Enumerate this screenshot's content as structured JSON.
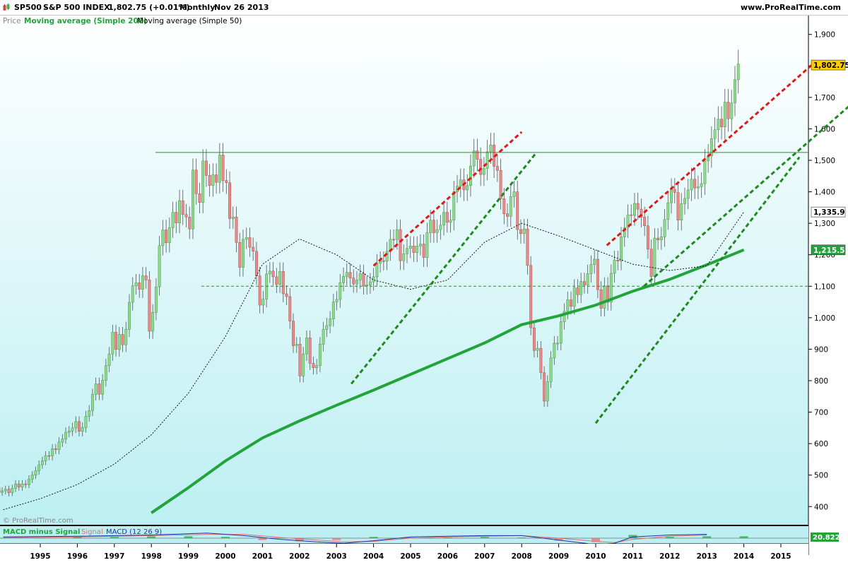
{
  "header": {
    "symbol": "SP500",
    "separator": "-",
    "name": "S&P 500 INDEX",
    "price_change": "1,802.75 (+0.01%)",
    "period": "Monthly",
    "date": "Nov 26 2013",
    "site": "www.ProRealTime.com"
  },
  "legend": {
    "price": "Price",
    "ma200": "Moving average (Simple 200)",
    "ma50": "Moving average (Simple 50)"
  },
  "macd_legend": {
    "hist": "MACD minus Signal",
    "signal": "Signal",
    "macd": "MACD (12 26 9)"
  },
  "watermark": "© ProRealTime.com",
  "colors": {
    "background_top": "#ffffff",
    "background_bottom": "#bff0f2",
    "up_candle": "#8fd98f",
    "down_candle": "#e88a8a",
    "ma200": "#22a43a",
    "ma50": "#000000",
    "support_line": "#1e8a1e",
    "resistance_line": "#e01818",
    "hline": "#2e8b2e",
    "price_badge": "#ffcc00",
    "ma200_badge": "#22a43a"
  },
  "chart_data": {
    "type": "candlestick",
    "period": "Monthly",
    "y_axis": {
      "ticks": [
        "400",
        "500",
        "600",
        "700",
        "800",
        "900",
        "1,000",
        "1,100",
        "1,200",
        "1,300",
        "1,400",
        "1,500",
        "1,600",
        "1,700",
        "1,800",
        "1,900"
      ],
      "tick_values": [
        400,
        500,
        600,
        700,
        800,
        900,
        1000,
        1100,
        1200,
        1300,
        1400,
        1500,
        1600,
        1700,
        1800,
        1900
      ],
      "range": [
        340,
        1960
      ]
    },
    "x_axis": {
      "ticks": [
        "1995",
        "1996",
        "1997",
        "1998",
        "1999",
        "2000",
        "2001",
        "2002",
        "2003",
        "2004",
        "2005",
        "2006",
        "2007",
        "2008",
        "2009",
        "2010",
        "2011",
        "2012",
        "2013",
        "2014",
        "2015"
      ],
      "range": [
        1994.0,
        2016.0
      ]
    },
    "last_price": {
      "value": 1802.75,
      "label": "1,802.75"
    },
    "ma50_last": {
      "value": 1335.9,
      "label": "1,335.9"
    },
    "ma200_last": {
      "value": 1215.5,
      "label": "1,215.5"
    },
    "closes": [
      [
        1994.0,
        476
      ],
      [
        1994.1,
        460
      ],
      [
        1994.2,
        445
      ],
      [
        1994.3,
        450
      ],
      [
        1994.4,
        455
      ],
      [
        1994.5,
        444
      ],
      [
        1994.6,
        458
      ],
      [
        1994.7,
        472
      ],
      [
        1994.8,
        462
      ],
      [
        1994.9,
        472
      ],
      [
        1995.0,
        470
      ],
      [
        1995.1,
        487
      ],
      [
        1995.2,
        500
      ],
      [
        1995.3,
        514
      ],
      [
        1995.4,
        533
      ],
      [
        1995.5,
        545
      ],
      [
        1995.6,
        562
      ],
      [
        1995.7,
        561
      ],
      [
        1995.8,
        584
      ],
      [
        1995.9,
        581
      ],
      [
        1996.0,
        605
      ],
      [
        1996.1,
        615
      ],
      [
        1996.2,
        636
      ],
      [
        1996.3,
        640
      ],
      [
        1996.4,
        650
      ],
      [
        1996.5,
        670
      ],
      [
        1996.6,
        639
      ],
      [
        1996.7,
        651
      ],
      [
        1996.8,
        687
      ],
      [
        1996.9,
        705
      ],
      [
        1997.0,
        756
      ],
      [
        1997.1,
        790
      ],
      [
        1997.2,
        757
      ],
      [
        1997.3,
        801
      ],
      [
        1997.4,
        848
      ],
      [
        1997.5,
        885
      ],
      [
        1997.6,
        954
      ],
      [
        1997.7,
        899
      ],
      [
        1997.8,
        947
      ],
      [
        1997.9,
        914
      ],
      [
        1998.0,
        963
      ],
      [
        1998.1,
        1049
      ],
      [
        1998.2,
        1101
      ],
      [
        1998.3,
        1111
      ],
      [
        1998.4,
        1090
      ],
      [
        1998.5,
        1133
      ],
      [
        1998.6,
        1120
      ],
      [
        1998.7,
        957
      ],
      [
        1998.8,
        1017
      ],
      [
        1998.9,
        1098
      ],
      [
        1999.0,
        1229
      ],
      [
        1999.1,
        1279
      ],
      [
        1999.2,
        1238
      ],
      [
        1999.3,
        1286
      ],
      [
        1999.4,
        1335
      ],
      [
        1999.5,
        1301
      ],
      [
        1999.6,
        1372
      ],
      [
        1999.7,
        1328
      ],
      [
        1999.8,
        1320
      ],
      [
        1999.9,
        1282
      ],
      [
        2000.0,
        1469
      ],
      [
        2000.1,
        1394
      ],
      [
        2000.2,
        1366
      ],
      [
        2000.3,
        1498
      ],
      [
        2000.4,
        1452
      ],
      [
        2000.5,
        1420
      ],
      [
        2000.6,
        1454
      ],
      [
        2000.7,
        1430
      ],
      [
        2000.8,
        1517
      ],
      [
        2000.9,
        1436
      ],
      [
        2001.0,
        1429
      ],
      [
        2001.1,
        1315
      ],
      [
        2001.2,
        1320
      ],
      [
        2001.3,
        1239
      ],
      [
        2001.4,
        1160
      ],
      [
        2001.5,
        1249
      ],
      [
        2001.6,
        1255
      ],
      [
        2001.7,
        1224
      ],
      [
        2001.8,
        1211
      ],
      [
        2001.9,
        1133
      ],
      [
        2002.0,
        1040
      ],
      [
        2002.1,
        1059
      ],
      [
        2002.2,
        1139
      ],
      [
        2002.3,
        1148
      ],
      [
        2002.4,
        1130
      ],
      [
        2002.5,
        1106
      ],
      [
        2002.6,
        1147
      ],
      [
        2002.7,
        1076
      ],
      [
        2002.8,
        1067
      ],
      [
        2002.9,
        989
      ],
      [
        2003.0,
        911
      ],
      [
        2003.1,
        916
      ],
      [
        2003.2,
        815
      ],
      [
        2003.3,
        885
      ],
      [
        2003.4,
        936
      ],
      [
        2003.5,
        855
      ],
      [
        2003.6,
        841
      ],
      [
        2003.7,
        848
      ],
      [
        2003.8,
        916
      ],
      [
        2003.9,
        963
      ],
      [
        2004.0,
        975
      ],
      [
        2004.1,
        996
      ],
      [
        2004.2,
        1050
      ],
      [
        2004.3,
        1058
      ],
      [
        2004.4,
        1111
      ],
      [
        2004.5,
        1131
      ],
      [
        2004.6,
        1144
      ],
      [
        2004.7,
        1126
      ],
      [
        2004.8,
        1107
      ],
      [
        2004.9,
        1120
      ],
      [
        2005.0,
        1140
      ],
      [
        2005.1,
        1101
      ],
      [
        2005.2,
        1104
      ],
      [
        2005.3,
        1114
      ],
      [
        2005.4,
        1130
      ],
      [
        2005.5,
        1173
      ],
      [
        2005.6,
        1181
      ],
      [
        2005.7,
        1180
      ],
      [
        2005.8,
        1211
      ],
      [
        2005.9,
        1249
      ],
      [
        2006.0,
        1248
      ],
      [
        2006.1,
        1280
      ],
      [
        2006.2,
        1181
      ],
      [
        2006.3,
        1203
      ],
      [
        2006.4,
        1220
      ],
      [
        2006.5,
        1228
      ],
      [
        2006.6,
        1207
      ],
      [
        2006.7,
        1228
      ],
      [
        2006.8,
        1234
      ],
      [
        2006.9,
        1191
      ],
      [
        2007.0,
        1270
      ],
      [
        2007.1,
        1310
      ],
      [
        2007.2,
        1270
      ],
      [
        2007.3,
        1280
      ],
      [
        2007.4,
        1294
      ],
      [
        2007.5,
        1335
      ],
      [
        2007.6,
        1303
      ],
      [
        2007.7,
        1310
      ],
      [
        2007.8,
        1400
      ],
      [
        2007.9,
        1418
      ],
      [
        2008.0,
        1438
      ],
      [
        2008.1,
        1406
      ],
      [
        2008.2,
        1420
      ],
      [
        2008.3,
        1482
      ],
      [
        2008.4,
        1530
      ],
      [
        2008.5,
        1503
      ],
      [
        2008.6,
        1455
      ],
      [
        2008.7,
        1474
      ],
      [
        2008.8,
        1527
      ],
      [
        2008.9,
        1549
      ],
      [
        2009.0,
        1481
      ],
      [
        2009.1,
        1468
      ],
      [
        2009.2,
        1378
      ],
      [
        2009.3,
        1330
      ],
      [
        2009.4,
        1322
      ],
      [
        2009.5,
        1385
      ],
      [
        2009.6,
        1400
      ],
      [
        2009.7,
        1280
      ],
      [
        2009.8,
        1267
      ],
      [
        2009.9,
        1282
      ],
      [
        2010.0,
        1166
      ],
      [
        2010.1,
        968
      ],
      [
        2010.2,
        896
      ],
      [
        2010.3,
        903
      ],
      [
        2010.4,
        825
      ],
      [
        2010.5,
        735
      ],
      [
        2010.6,
        797
      ],
      [
        2010.7,
        872
      ],
      [
        2010.8,
        919
      ],
      [
        2010.9,
        919
      ],
      [
        2011.0,
        987
      ],
      [
        2011.1,
        1020
      ],
      [
        2011.2,
        1057
      ],
      [
        2011.3,
        1036
      ],
      [
        2011.4,
        1095
      ],
      [
        2011.5,
        1073
      ],
      [
        2011.6,
        1115
      ],
      [
        2011.7,
        1104
      ],
      [
        2011.8,
        1140
      ],
      [
        2011.9,
        1169
      ],
      [
        2012.0,
        1186
      ],
      [
        2012.1,
        1089
      ],
      [
        2012.2,
        1030
      ],
      [
        2012.3,
        1101
      ],
      [
        2012.4,
        1049
      ],
      [
        2012.5,
        1141
      ],
      [
        2012.6,
        1183
      ],
      [
        2012.7,
        1180
      ],
      [
        2012.8,
        1257
      ],
      [
        2012.9,
        1286
      ],
      [
        2013.0,
        1327
      ],
      [
        2013.1,
        1325
      ],
      [
        2013.2,
        1363
      ],
      [
        2013.3,
        1345
      ],
      [
        2013.4,
        1320
      ],
      [
        2013.5,
        1292
      ],
      [
        2013.6,
        1218
      ],
      [
        2013.7,
        1131
      ],
      [
        2013.8,
        1253
      ],
      [
        2013.9,
        1247
      ],
      [
        2014.0,
        1257
      ],
      [
        2014.1,
        1312
      ],
      [
        2014.2,
        1365
      ],
      [
        2014.3,
        1408
      ],
      [
        2014.4,
        1398
      ],
      [
        2014.5,
        1310
      ],
      [
        2014.6,
        1362
      ],
      [
        2014.7,
        1379
      ],
      [
        2014.8,
        1406
      ],
      [
        2014.9,
        1440
      ],
      [
        2015.0,
        1412
      ],
      [
        2015.1,
        1416
      ],
      [
        2015.2,
        1426
      ],
      [
        2015.3,
        1498
      ],
      [
        2015.4,
        1514
      ],
      [
        2015.5,
        1569
      ],
      [
        2015.6,
        1597
      ],
      [
        2015.7,
        1631
      ],
      [
        2015.8,
        1606
      ],
      [
        2015.9,
        1685
      ],
      [
        2016.0,
        1632
      ],
      [
        2016.1,
        1682
      ],
      [
        2016.2,
        1756
      ],
      [
        2016.3,
        1806
      ]
    ],
    "lines": {
      "ma200": [
        [
          1998.0,
          380
        ],
        [
          1999.0,
          460
        ],
        [
          2000.0,
          545
        ],
        [
          2001.0,
          618
        ],
        [
          2002.0,
          672
        ],
        [
          2003.0,
          722
        ],
        [
          2004.0,
          770
        ],
        [
          2005.0,
          820
        ],
        [
          2006.0,
          870
        ],
        [
          2007.0,
          920
        ],
        [
          2008.0,
          978
        ],
        [
          2009.0,
          1006
        ],
        [
          2010.0,
          1040
        ],
        [
          2011.0,
          1084
        ],
        [
          2012.0,
          1122
        ],
        [
          2013.0,
          1168
        ],
        [
          2014.0,
          1215.5
        ]
      ],
      "ma50": [
        [
          1994.0,
          390
        ],
        [
          1995.0,
          425
        ],
        [
          1996.0,
          470
        ],
        [
          1997.0,
          535
        ],
        [
          1998.0,
          628
        ],
        [
          1999.0,
          760
        ],
        [
          2000.0,
          940
        ],
        [
          2001.0,
          1170
        ],
        [
          2002.0,
          1250
        ],
        [
          2003.0,
          1200
        ],
        [
          2004.0,
          1120
        ],
        [
          2005.0,
          1090
        ],
        [
          2006.0,
          1120
        ],
        [
          2007.0,
          1240
        ],
        [
          2008.0,
          1300
        ],
        [
          2009.0,
          1260
        ],
        [
          2010.0,
          1215
        ],
        [
          2011.0,
          1170
        ],
        [
          2012.0,
          1150
        ],
        [
          2013.0,
          1165
        ],
        [
          2014.0,
          1335.9
        ]
      ],
      "support_line": [
        1520,
        1520
      ]
    },
    "annotations": {
      "resistance_1": [
        [
          2004.0,
          1165
        ],
        [
          2008.0,
          1590
        ]
      ],
      "support_1": [
        [
          2003.4,
          790
        ],
        [
          2008.4,
          1525
        ]
      ],
      "resistance_2": [
        [
          2010.3,
          1230
        ],
        [
          2016.0,
          1820
        ]
      ],
      "support_2": [
        [
          2010.0,
          665
        ],
        [
          2015.5,
          1510
        ]
      ],
      "support_3": [
        [
          2011.3,
          1100
        ],
        [
          2017.5,
          1740
        ]
      ],
      "hline_1520": 1525,
      "hline_1100": 1100
    }
  },
  "macd": {
    "y_axis": {
      "ticks": [
        "20.822"
      ],
      "label": "20.822"
    },
    "hist": [
      [
        1994.0,
        0
      ],
      [
        1995.0,
        0
      ],
      [
        1996.0,
        2
      ],
      [
        1997.0,
        2
      ],
      [
        1998.0,
        3
      ],
      [
        1999.0,
        3
      ],
      [
        2000.0,
        2
      ],
      [
        2001.0,
        -3
      ],
      [
        2002.0,
        -5
      ],
      [
        2003.0,
        -3
      ],
      [
        2004.0,
        2
      ],
      [
        2005.0,
        1
      ],
      [
        2006.0,
        1
      ],
      [
        2007.0,
        2
      ],
      [
        2008.0,
        1
      ],
      [
        2009.0,
        -4
      ],
      [
        2010.0,
        -6
      ],
      [
        2011.0,
        5
      ],
      [
        2012.0,
        2
      ],
      [
        2013.0,
        3
      ],
      [
        2014.0,
        3
      ]
    ],
    "macd_line": [
      [
        1994.0,
        2
      ],
      [
        1996.0,
        3
      ],
      [
        1998.0,
        5
      ],
      [
        1999.5,
        8
      ],
      [
        2000.5,
        4
      ],
      [
        2001.5,
        -2
      ],
      [
        2002.5,
        -6
      ],
      [
        2003.2,
        -8
      ],
      [
        2004.0,
        -4
      ],
      [
        2005.0,
        2
      ],
      [
        2006.0,
        3
      ],
      [
        2007.0,
        4
      ],
      [
        2008.0,
        4
      ],
      [
        2009.0,
        -3
      ],
      [
        2010.0,
        -10
      ],
      [
        2010.5,
        -8
      ],
      [
        2011.0,
        2
      ],
      [
        2012.0,
        5
      ],
      [
        2013.0,
        6
      ],
      [
        2014.0,
        10
      ],
      [
        2015.0,
        14
      ],
      [
        2016.0,
        16
      ]
    ],
    "signal_line": [
      [
        1994.0,
        1
      ],
      [
        1996.0,
        2
      ],
      [
        1998.0,
        4
      ],
      [
        1999.5,
        6
      ],
      [
        2000.5,
        6
      ],
      [
        2001.5,
        1
      ],
      [
        2002.5,
        -3
      ],
      [
        2003.2,
        -6
      ],
      [
        2004.0,
        -5
      ],
      [
        2005.0,
        0
      ],
      [
        2006.0,
        2
      ],
      [
        2007.0,
        3
      ],
      [
        2008.0,
        4
      ],
      [
        2009.0,
        0
      ],
      [
        2010.0,
        -5
      ],
      [
        2010.5,
        -7
      ],
      [
        2011.0,
        -2
      ],
      [
        2012.0,
        3
      ],
      [
        2013.0,
        5
      ],
      [
        2014.0,
        8
      ],
      [
        2015.0,
        12
      ],
      [
        2016.0,
        14
      ]
    ]
  }
}
